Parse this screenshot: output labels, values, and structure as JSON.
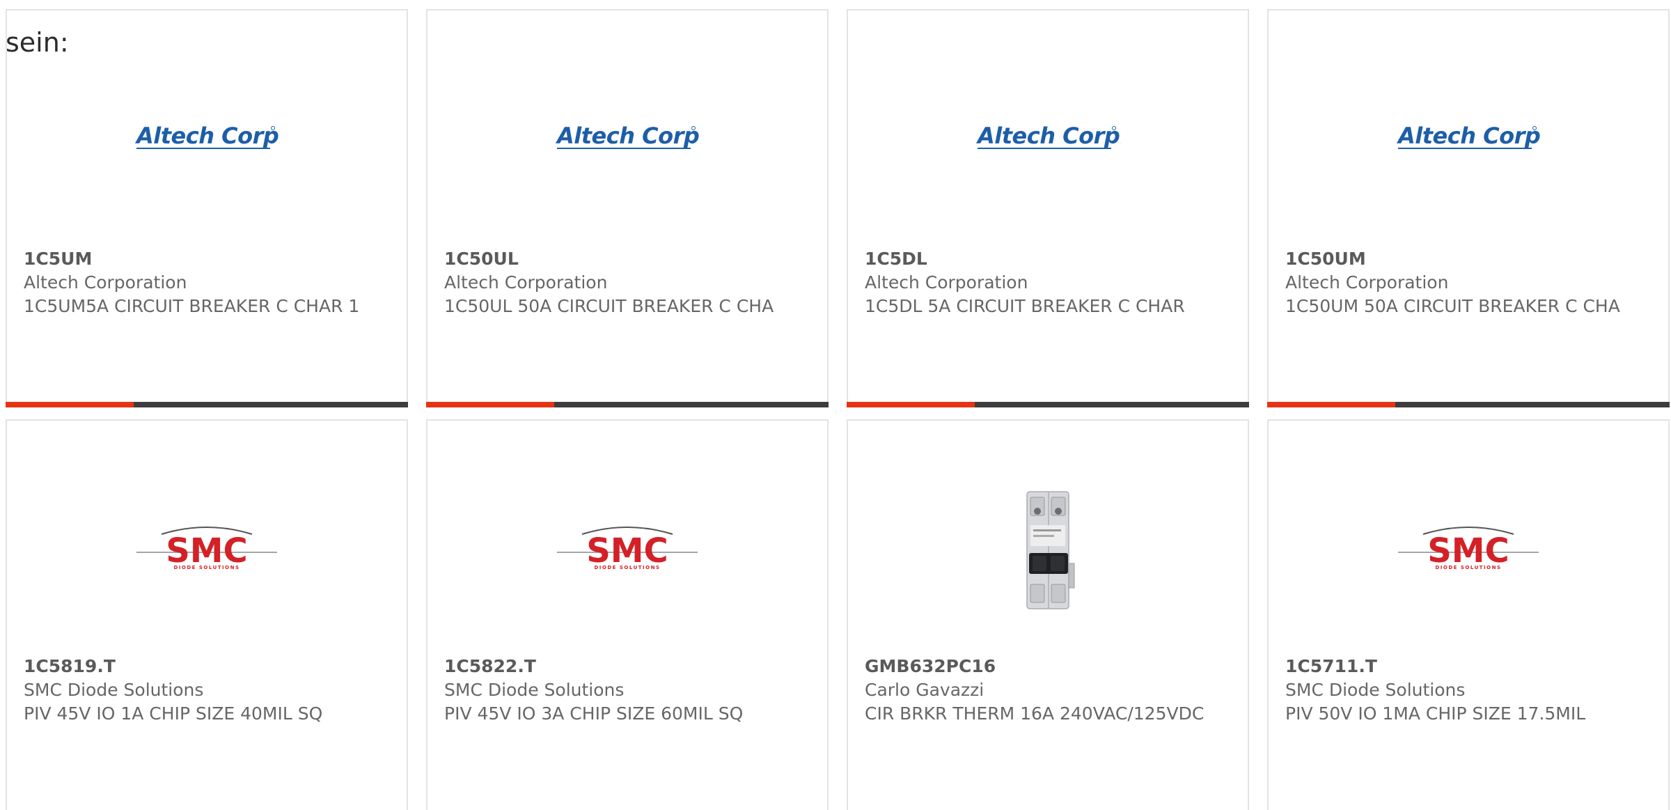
{
  "intro_text": "sein:",
  "brand": {
    "accent": "#e63312",
    "bar_dark": "#3d3d3d",
    "altech_blue": "#1d5ea8",
    "smc_red": "#d42027"
  },
  "products": [
    {
      "part": "1C5UM",
      "manufacturer": "Altech Corporation",
      "description": "1C5UM5A CIRCUIT BREAKER C CHAR 1",
      "image": "altech-logo",
      "logo_text": "Altech Corp."
    },
    {
      "part": "1C50UL",
      "manufacturer": "Altech Corporation",
      "description": "1C50UL 50A CIRCUIT BREAKER C CHA",
      "image": "altech-logo",
      "logo_text": "Altech Corp."
    },
    {
      "part": "1C5DL",
      "manufacturer": "Altech Corporation",
      "description": "1C5DL 5A CIRCUIT BREAKER C CHAR",
      "image": "altech-logo",
      "logo_text": "Altech Corp."
    },
    {
      "part": "1C50UM",
      "manufacturer": "Altech Corporation",
      "description": "1C50UM 50A CIRCUIT BREAKER C CHA",
      "image": "altech-logo",
      "logo_text": "Altech Corp."
    },
    {
      "part": "1C5819.T",
      "manufacturer": "SMC Diode Solutions",
      "description": "PIV 45V IO 1A CHIP SIZE 40MIL SQ",
      "image": "smc-logo",
      "logo_text": "SMC",
      "logo_subtext": "DIODE SOLUTIONS"
    },
    {
      "part": "1C5822.T",
      "manufacturer": "SMC Diode Solutions",
      "description": "PIV 45V IO 3A CHIP SIZE 60MIL SQ",
      "image": "smc-logo",
      "logo_text": "SMC",
      "logo_subtext": "DIODE SOLUTIONS"
    },
    {
      "part": "GMB632PC16",
      "manufacturer": "Carlo Gavazzi",
      "description": "CIR BRKR THERM 16A 240VAC/125VDC",
      "image": "circuit-breaker-photo"
    },
    {
      "part": "1C5711.T",
      "manufacturer": "SMC Diode Solutions",
      "description": "PIV 50V IO 1MA CHIP SIZE 17.5MIL",
      "image": "smc-logo",
      "logo_text": "SMC",
      "logo_subtext": "DIODE SOLUTIONS"
    }
  ]
}
